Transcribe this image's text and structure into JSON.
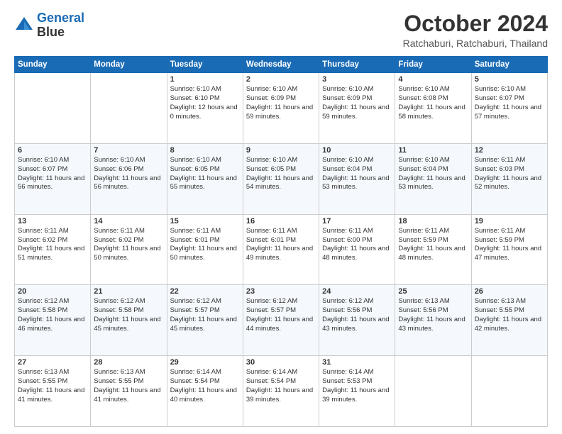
{
  "header": {
    "logo_line1": "General",
    "logo_line2": "Blue",
    "month": "October 2024",
    "location": "Ratchaburi, Ratchaburi, Thailand"
  },
  "weekdays": [
    "Sunday",
    "Monday",
    "Tuesday",
    "Wednesday",
    "Thursday",
    "Friday",
    "Saturday"
  ],
  "weeks": [
    [
      {
        "day": "",
        "sunrise": "",
        "sunset": "",
        "daylight": ""
      },
      {
        "day": "",
        "sunrise": "",
        "sunset": "",
        "daylight": ""
      },
      {
        "day": "1",
        "sunrise": "Sunrise: 6:10 AM",
        "sunset": "Sunset: 6:10 PM",
        "daylight": "Daylight: 12 hours and 0 minutes."
      },
      {
        "day": "2",
        "sunrise": "Sunrise: 6:10 AM",
        "sunset": "Sunset: 6:09 PM",
        "daylight": "Daylight: 11 hours and 59 minutes."
      },
      {
        "day": "3",
        "sunrise": "Sunrise: 6:10 AM",
        "sunset": "Sunset: 6:09 PM",
        "daylight": "Daylight: 11 hours and 59 minutes."
      },
      {
        "day": "4",
        "sunrise": "Sunrise: 6:10 AM",
        "sunset": "Sunset: 6:08 PM",
        "daylight": "Daylight: 11 hours and 58 minutes."
      },
      {
        "day": "5",
        "sunrise": "Sunrise: 6:10 AM",
        "sunset": "Sunset: 6:07 PM",
        "daylight": "Daylight: 11 hours and 57 minutes."
      }
    ],
    [
      {
        "day": "6",
        "sunrise": "Sunrise: 6:10 AM",
        "sunset": "Sunset: 6:07 PM",
        "daylight": "Daylight: 11 hours and 56 minutes."
      },
      {
        "day": "7",
        "sunrise": "Sunrise: 6:10 AM",
        "sunset": "Sunset: 6:06 PM",
        "daylight": "Daylight: 11 hours and 56 minutes."
      },
      {
        "day": "8",
        "sunrise": "Sunrise: 6:10 AM",
        "sunset": "Sunset: 6:05 PM",
        "daylight": "Daylight: 11 hours and 55 minutes."
      },
      {
        "day": "9",
        "sunrise": "Sunrise: 6:10 AM",
        "sunset": "Sunset: 6:05 PM",
        "daylight": "Daylight: 11 hours and 54 minutes."
      },
      {
        "day": "10",
        "sunrise": "Sunrise: 6:10 AM",
        "sunset": "Sunset: 6:04 PM",
        "daylight": "Daylight: 11 hours and 53 minutes."
      },
      {
        "day": "11",
        "sunrise": "Sunrise: 6:10 AM",
        "sunset": "Sunset: 6:04 PM",
        "daylight": "Daylight: 11 hours and 53 minutes."
      },
      {
        "day": "12",
        "sunrise": "Sunrise: 6:11 AM",
        "sunset": "Sunset: 6:03 PM",
        "daylight": "Daylight: 11 hours and 52 minutes."
      }
    ],
    [
      {
        "day": "13",
        "sunrise": "Sunrise: 6:11 AM",
        "sunset": "Sunset: 6:02 PM",
        "daylight": "Daylight: 11 hours and 51 minutes."
      },
      {
        "day": "14",
        "sunrise": "Sunrise: 6:11 AM",
        "sunset": "Sunset: 6:02 PM",
        "daylight": "Daylight: 11 hours and 50 minutes."
      },
      {
        "day": "15",
        "sunrise": "Sunrise: 6:11 AM",
        "sunset": "Sunset: 6:01 PM",
        "daylight": "Daylight: 11 hours and 50 minutes."
      },
      {
        "day": "16",
        "sunrise": "Sunrise: 6:11 AM",
        "sunset": "Sunset: 6:01 PM",
        "daylight": "Daylight: 11 hours and 49 minutes."
      },
      {
        "day": "17",
        "sunrise": "Sunrise: 6:11 AM",
        "sunset": "Sunset: 6:00 PM",
        "daylight": "Daylight: 11 hours and 48 minutes."
      },
      {
        "day": "18",
        "sunrise": "Sunrise: 6:11 AM",
        "sunset": "Sunset: 5:59 PM",
        "daylight": "Daylight: 11 hours and 48 minutes."
      },
      {
        "day": "19",
        "sunrise": "Sunrise: 6:11 AM",
        "sunset": "Sunset: 5:59 PM",
        "daylight": "Daylight: 11 hours and 47 minutes."
      }
    ],
    [
      {
        "day": "20",
        "sunrise": "Sunrise: 6:12 AM",
        "sunset": "Sunset: 5:58 PM",
        "daylight": "Daylight: 11 hours and 46 minutes."
      },
      {
        "day": "21",
        "sunrise": "Sunrise: 6:12 AM",
        "sunset": "Sunset: 5:58 PM",
        "daylight": "Daylight: 11 hours and 45 minutes."
      },
      {
        "day": "22",
        "sunrise": "Sunrise: 6:12 AM",
        "sunset": "Sunset: 5:57 PM",
        "daylight": "Daylight: 11 hours and 45 minutes."
      },
      {
        "day": "23",
        "sunrise": "Sunrise: 6:12 AM",
        "sunset": "Sunset: 5:57 PM",
        "daylight": "Daylight: 11 hours and 44 minutes."
      },
      {
        "day": "24",
        "sunrise": "Sunrise: 6:12 AM",
        "sunset": "Sunset: 5:56 PM",
        "daylight": "Daylight: 11 hours and 43 minutes."
      },
      {
        "day": "25",
        "sunrise": "Sunrise: 6:13 AM",
        "sunset": "Sunset: 5:56 PM",
        "daylight": "Daylight: 11 hours and 43 minutes."
      },
      {
        "day": "26",
        "sunrise": "Sunrise: 6:13 AM",
        "sunset": "Sunset: 5:55 PM",
        "daylight": "Daylight: 11 hours and 42 minutes."
      }
    ],
    [
      {
        "day": "27",
        "sunrise": "Sunrise: 6:13 AM",
        "sunset": "Sunset: 5:55 PM",
        "daylight": "Daylight: 11 hours and 41 minutes."
      },
      {
        "day": "28",
        "sunrise": "Sunrise: 6:13 AM",
        "sunset": "Sunset: 5:55 PM",
        "daylight": "Daylight: 11 hours and 41 minutes."
      },
      {
        "day": "29",
        "sunrise": "Sunrise: 6:14 AM",
        "sunset": "Sunset: 5:54 PM",
        "daylight": "Daylight: 11 hours and 40 minutes."
      },
      {
        "day": "30",
        "sunrise": "Sunrise: 6:14 AM",
        "sunset": "Sunset: 5:54 PM",
        "daylight": "Daylight: 11 hours and 39 minutes."
      },
      {
        "day": "31",
        "sunrise": "Sunrise: 6:14 AM",
        "sunset": "Sunset: 5:53 PM",
        "daylight": "Daylight: 11 hours and 39 minutes."
      },
      {
        "day": "",
        "sunrise": "",
        "sunset": "",
        "daylight": ""
      },
      {
        "day": "",
        "sunrise": "",
        "sunset": "",
        "daylight": ""
      }
    ]
  ]
}
